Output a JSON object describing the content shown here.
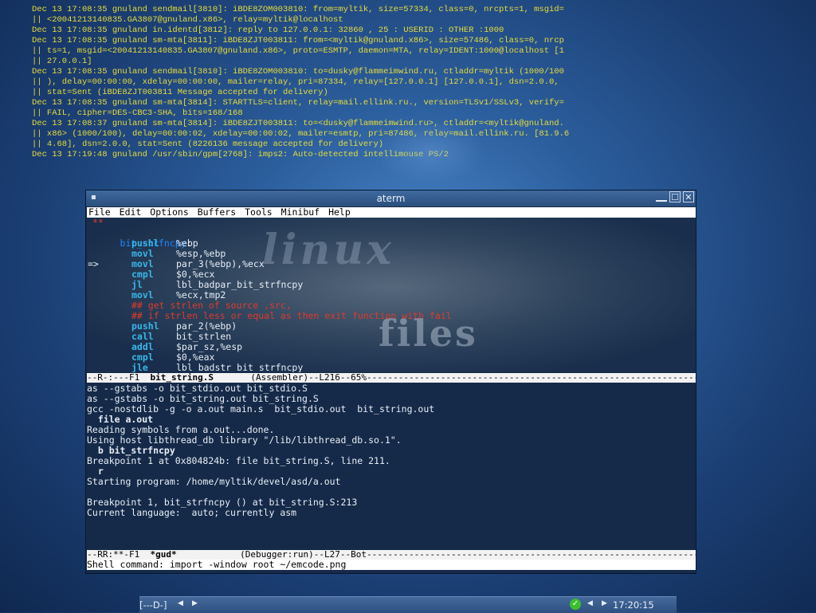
{
  "syslog": {
    "lines": [
      "Dec 13 17:08:35 gnuland sendmail[3810]: iBDE8ZOM003810: from=myltik, size=57334, class=0, nrcpts=1, msgid=",
      "|| <20041213140835.GA3807@gnuland.x86>, relay=myltik@localhost",
      "Dec 13 17:08:35 gnuland in.identd[3812]: reply to 127.0.0.1: 32860 , 25 : USERID : OTHER :1000",
      "Dec 13 17:08:35 gnuland sm-mta[3811]: iBDE8ZJT003811: from=<myltik@gnuland.x86>, size=57486, class=0, nrcp",
      "|| ts=1, msgid=<20041213140835.GA3807@gnuland.x86>, proto=ESMTP, daemon=MTA, relay=IDENT:1000@localhost [1",
      "|| 27.0.0.1]",
      "Dec 13 17:08:35 gnuland sendmail[3810]: iBDE8ZOM003810: to=dusky@flammeimwind.ru, ctladdr=myltik (1000/100",
      "|| ), delay=00:00:00, xdelay=00:00:00, mailer=relay, pri=87334, relay=[127.0.0.1] [127.0.0.1], dsn=2.0.0,",
      "|| stat=Sent (iBDE8ZJT003811 Message accepted for delivery)",
      "Dec 13 17:08:35 gnuland sm-mta[3814]: STARTTLS=client, relay=mail.ellink.ru., version=TLSv1/SSLv3, verify=",
      "|| FAIL, cipher=DES-CBC3-SHA, bits=168/168",
      "Dec 13 17:08:37 gnuland sm-mta[3814]: iBDE8ZJT003811: to=<dusky@flammeimwind.ru>, ctladdr=<myltik@gnuland.",
      "|| x86> (1000/100), delay=00:00:02, xdelay=00:00:02, mailer=esmtp, pri=87486, relay=mail.ellink.ru. [81.9.6",
      "|| 4.68], dsn=2.0.0, stat=Sent (8226136 message accepted for delivery)",
      "Dec 13 17:19:48 gnuland /usr/sbin/gpm[2768]: imps2: Auto-detected intellimouse PS/2"
    ]
  },
  "window": {
    "title": "aterm",
    "menu_icon": "▪",
    "minimize": "",
    "maximize": "☐",
    "close": "✕"
  },
  "menubar": [
    "File",
    "Edit",
    "Options",
    "Buffers",
    "Tools",
    "Minibuf",
    "Help"
  ],
  "editor": {
    "top_stars": " **",
    "label": "bit_strfncpy",
    "label_colon": ":",
    "arrow": "=>",
    "lines": [
      {
        "kind": "instr",
        "op": "pushl",
        "arg": "%ebp"
      },
      {
        "kind": "instr",
        "op": "movl",
        "arg": "%esp,%ebp"
      },
      {
        "kind": "instr",
        "op": "movl",
        "arg": "par_3(%ebp),%ecx"
      },
      {
        "kind": "instr",
        "op": "cmpl",
        "arg": "$0,%ecx"
      },
      {
        "kind": "instr",
        "op": "jl",
        "arg": "lbl_badpar_bit_strfncpy"
      },
      {
        "kind": "instr",
        "op": "movl",
        "arg": "%ecx,tmp2"
      },
      {
        "kind": "comment",
        "text": "## get strlen of source ,src,"
      },
      {
        "kind": "comment",
        "text": "## if strlen less or equal as then exit function with fail"
      },
      {
        "kind": "instr",
        "op": "pushl",
        "arg": "par_2(%ebp)"
      },
      {
        "kind": "instr",
        "op": "call",
        "arg": "bit_strlen"
      },
      {
        "kind": "instr",
        "op": "addl",
        "arg": "$par_sz,%esp"
      },
      {
        "kind": "instr",
        "op": "cmpl",
        "arg": "$0,%eax"
      },
      {
        "kind": "instr",
        "op": "jle",
        "arg": "lbl_badstr_bit_strfncpy"
      }
    ],
    "watermark_top": "linux",
    "watermark_bottom": "files"
  },
  "modeline1": {
    "prefix": "--R-:---F1  ",
    "buffer": "bit_string.S",
    "suffix": "       (Assembler)--L216--65%------------------------------------------------------------------------------------"
  },
  "gud": {
    "lines": [
      {
        "text": "as --gstabs -o bit_stdio.out bit_stdio.S",
        "bold": false
      },
      {
        "text": "as --gstabs -o bit_string.out bit_string.S",
        "bold": false
      },
      {
        "text": "gcc -nostdlib -g -o a.out main.s  bit_stdio.out  bit_string.out",
        "bold": false
      },
      {
        "text": "  file a.out",
        "bold": true
      },
      {
        "text": "Reading symbols from a.out...done.",
        "bold": false
      },
      {
        "text": "Using host libthread_db library \"/lib/libthread_db.so.1\".",
        "bold": false
      },
      {
        "text": "  b bit_strfncpy",
        "bold": true
      },
      {
        "text": "Breakpoint 1 at 0x804824b: file bit_string.S, line 211.",
        "bold": false
      },
      {
        "text": "  r",
        "bold": true
      },
      {
        "text": "Starting program: /home/myltik/devel/asd/a.out",
        "bold": false
      },
      {
        "text": "",
        "bold": false
      },
      {
        "text": "Breakpoint 1, bit_strfncpy () at bit_string.S:213",
        "bold": false
      },
      {
        "text": "Current language:  auto; currently asm",
        "bold": false
      }
    ]
  },
  "modeline2": {
    "prefix": "--RR:**-F1  ",
    "buffer": "*gud*",
    "suffix": "            (Debugger:run)--L27--Bot---------------------------------------------------------------------------------"
  },
  "minibuffer": "Shell command: import -window root ~/emcode.png",
  "taskbar": {
    "desk": "[---D-]",
    "left_prev": "◀",
    "left_next": "▶",
    "check": "✓",
    "right_prev": "◀",
    "right_next": "▶",
    "clock": "17:20:15"
  }
}
